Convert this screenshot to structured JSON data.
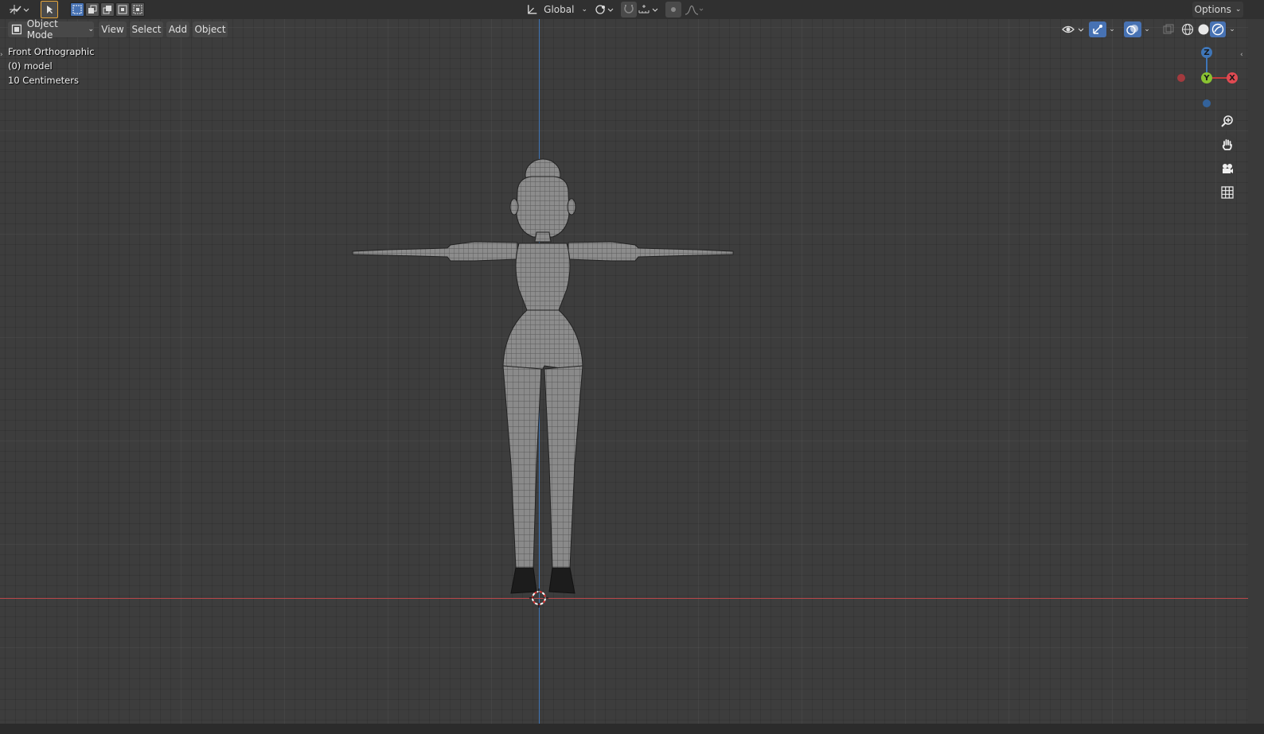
{
  "toolbar": {
    "transform_orientation": "Global",
    "options_label": "Options"
  },
  "header": {
    "mode_label": "Object Mode",
    "menus": [
      "View",
      "Select",
      "Add",
      "Object"
    ]
  },
  "viewport_info": {
    "view_name": "Front Orthographic",
    "object_line": "(0) model",
    "grid_scale": "10 Centimeters"
  },
  "gizmo": {
    "z_label": "Z",
    "y_label": "Y",
    "x_label": "X"
  },
  "colors": {
    "x_axis": "#c43c3c",
    "z_axis": "#3f76b8",
    "y_axis": "#89c232",
    "active_tool": "#e6a53a",
    "accent": "#4772b3"
  },
  "icons": [
    "editor-type-icon",
    "select-cursor-icon",
    "select-box-icon",
    "transform-orientation-icon",
    "pivot-icon",
    "snap-icon",
    "proportional-edit-icon",
    "visibility-icon",
    "gizmo-toggle-icon",
    "overlay-icon",
    "xray-icon",
    "wireframe-shading-icon",
    "solid-shading-icon",
    "material-shading-icon",
    "zoom-icon",
    "hand-pan-icon",
    "camera-icon",
    "grid-icon",
    "3d-cursor-icon"
  ]
}
